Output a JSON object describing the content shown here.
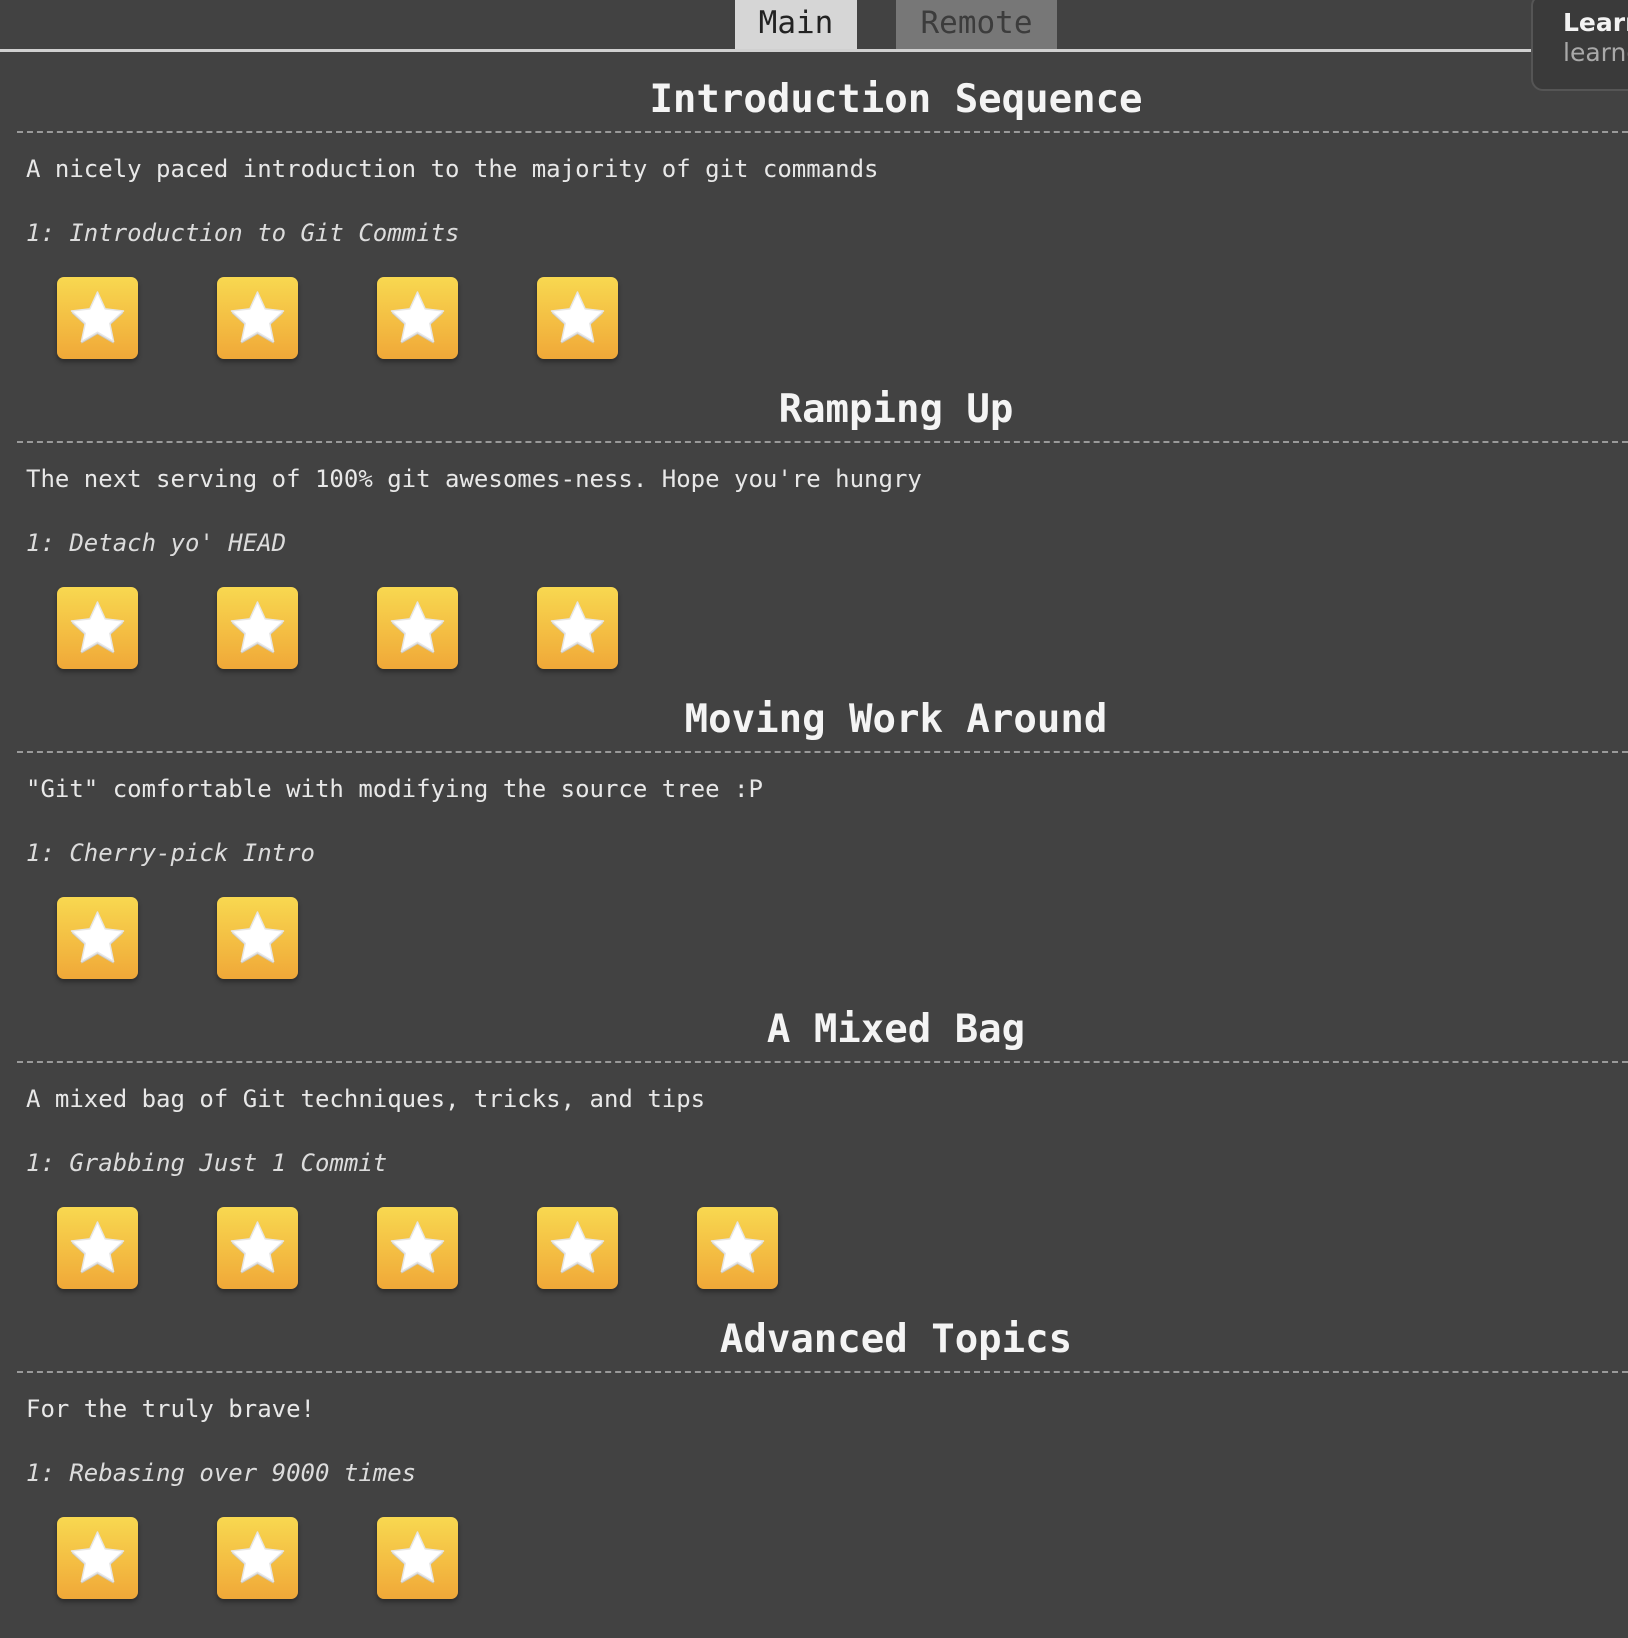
{
  "tabs": {
    "main": "Main",
    "remote": "Remote"
  },
  "popover": {
    "title": "Learn",
    "subtitle": "learng"
  },
  "sequences": [
    {
      "title": "Introduction Sequence",
      "about": "A nicely paced introduction to the majority of git commands",
      "level": "1: Introduction to Git Commits",
      "stars": 4
    },
    {
      "title": "Ramping Up",
      "about": "The next serving of 100% git awesomes-ness. Hope you're hungry",
      "level": "1: Detach yo' HEAD",
      "stars": 4
    },
    {
      "title": "Moving Work Around",
      "about": "\"Git\" comfortable with modifying the source tree :P",
      "level": "1: Cherry-pick Intro",
      "stars": 2
    },
    {
      "title": "A Mixed Bag",
      "about": "A mixed bag of Git techniques, tricks, and tips",
      "level": "1: Grabbing Just 1 Commit",
      "stars": 5
    },
    {
      "title": "Advanced Topics",
      "about": "For the truly brave!",
      "level": "1: Rebasing over 9000 times",
      "stars": 3
    }
  ],
  "colors": {
    "background": "#424242",
    "star_top": "#f8d850",
    "star_bottom": "#f0a838"
  },
  "icons": {
    "level_button": "star-icon"
  }
}
